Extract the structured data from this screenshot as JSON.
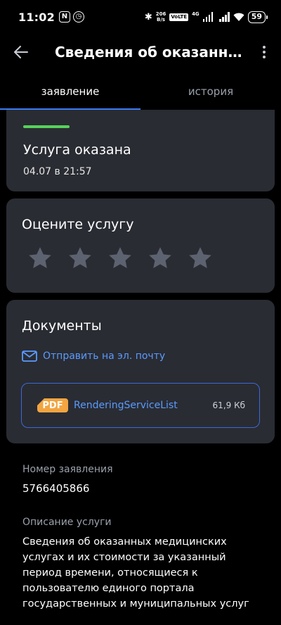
{
  "status_bar": {
    "time": "11:02",
    "speed_top": "206",
    "speed_bottom": "B/s",
    "volte": "VoLTE",
    "net": "4G",
    "battery": "59"
  },
  "header": {
    "title": "Сведения об оказанны..."
  },
  "tabs": [
    {
      "label": "заявление",
      "active": true
    },
    {
      "label": "история",
      "active": false
    }
  ],
  "status_card": {
    "title": "Услуга оказана",
    "date": "04.07 в 21:57",
    "accent_color": "#55d35b"
  },
  "rating": {
    "title": "Оцените услугу",
    "stars_total": 5,
    "stars_selected": 0
  },
  "documents": {
    "title": "Документы",
    "email_label": "Отправить на эл. почту",
    "file": {
      "type": "PDF",
      "name": "RenderingServiceList",
      "size": "61,9 Кб"
    }
  },
  "application": {
    "number_label": "Номер заявления",
    "number": "5766405866",
    "description_label": "Описание услуги",
    "description": "Сведения об оказанных медицинских услугах и их стоимости за указанный период времени, относящиеся к пользователю единого портала государственных и муниципальных услуг"
  },
  "colors": {
    "background": "#000000",
    "card": "#2a2c33",
    "accent_blue": "#3b7cf0",
    "link_blue": "#5a9bff",
    "pdf_orange": "#f2a541"
  }
}
